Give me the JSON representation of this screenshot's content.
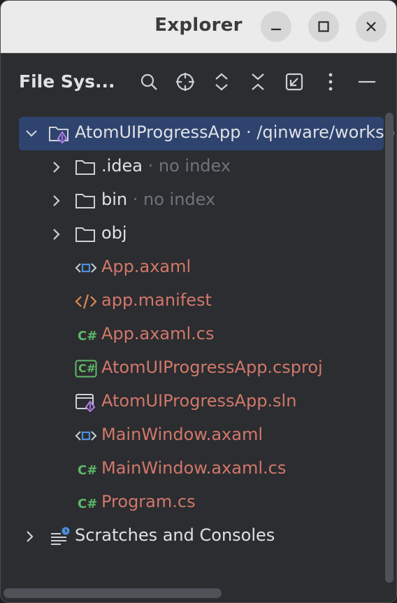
{
  "window": {
    "title": "Explorer"
  },
  "toolbar": {
    "panel_title": "File Sys..."
  },
  "tree": {
    "root": {
      "name": "AtomUIProgressApp",
      "path": " · /qinware/worksp"
    },
    "items": [
      {
        "label": ".idea",
        "hint": " · no index",
        "icon": "folder-icon",
        "color": "#dfe1e5"
      },
      {
        "label": "bin",
        "hint": " · no index",
        "icon": "folder-icon",
        "color": "#dfe1e5"
      },
      {
        "label": "obj",
        "hint": "",
        "icon": "folder-icon",
        "color": "#dfe1e5"
      },
      {
        "label": "App.axaml",
        "icon": "axaml-file-icon",
        "color": "#d2776a"
      },
      {
        "label": "app.manifest",
        "icon": "xml-file-icon",
        "color": "#d2776a"
      },
      {
        "label": "App.axaml.cs",
        "icon": "csharp-file-icon",
        "color": "#d2776a"
      },
      {
        "label": "AtomUIProgressApp.csproj",
        "icon": "csproj-file-icon",
        "color": "#d2776a"
      },
      {
        "label": "AtomUIProgressApp.sln",
        "icon": "sln-file-icon",
        "color": "#d2776a"
      },
      {
        "label": "MainWindow.axaml",
        "icon": "axaml-file-icon",
        "color": "#d2776a"
      },
      {
        "label": "MainWindow.axaml.cs",
        "icon": "csharp-file-icon",
        "color": "#d2776a"
      },
      {
        "label": "Program.cs",
        "icon": "csharp-file-icon",
        "color": "#d2776a"
      }
    ],
    "scratches": {
      "label": "Scratches and Consoles"
    }
  }
}
